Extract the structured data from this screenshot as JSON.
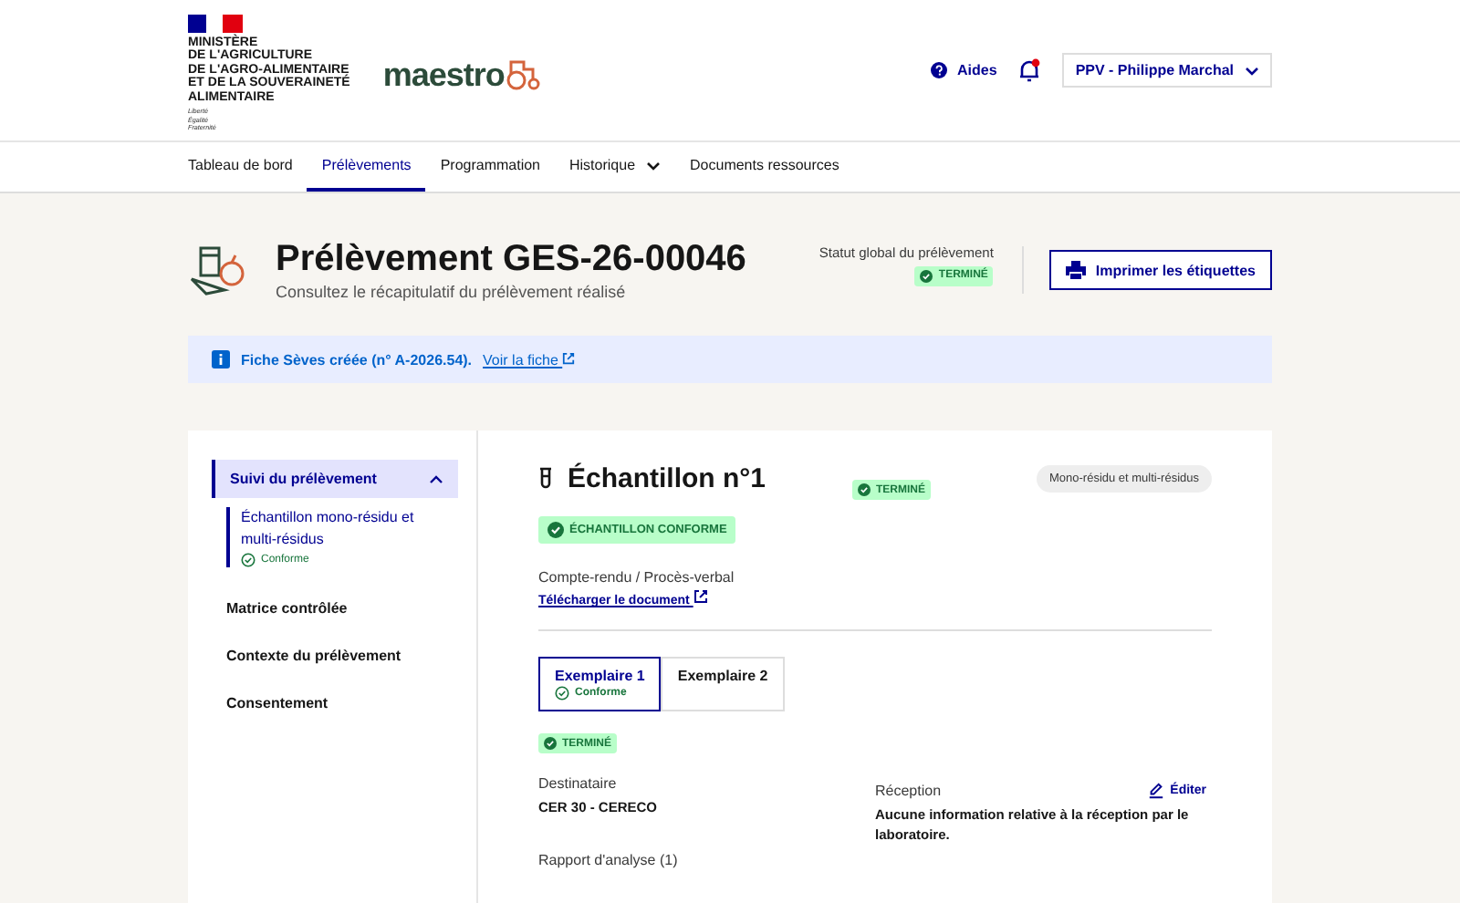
{
  "header": {
    "ministry": [
      "MINISTÈRE",
      "DE L'AGRICULTURE",
      "DE L'AGRO-ALIMENTAIRE",
      "ET DE LA SOUVERAINETÉ",
      "ALIMENTAIRE"
    ],
    "motto": [
      "Liberté",
      "Égalité",
      "Fraternité"
    ],
    "app_name": "maestro",
    "help": "Aides",
    "notifications_unread": true,
    "user": "PPV - Philippe Marchal"
  },
  "nav": [
    {
      "label": "Tableau de bord",
      "selected": false,
      "has_menu": false
    },
    {
      "label": "Prélèvements",
      "selected": true,
      "has_menu": false
    },
    {
      "label": "Programmation",
      "selected": false,
      "has_menu": false
    },
    {
      "label": "Historique",
      "selected": false,
      "has_menu": true
    },
    {
      "label": "Documents ressources",
      "selected": false,
      "has_menu": false
    }
  ],
  "page": {
    "title": "Prélèvement GES-26-00046",
    "subtitle": "Consultez le récapitulatif du prélèvement réalisé",
    "status_label": "Statut global du prélèvement",
    "status": "TERMINÉ",
    "print_button": "Imprimer les étiquettes"
  },
  "alert": {
    "text": "Fiche Sèves créée (n° A-2026.54).",
    "link": "Voir la fiche"
  },
  "sidebar": [
    {
      "label": "Suivi du prélèvement",
      "selected": true,
      "expanded": true,
      "children": [
        {
          "label": "Échantillon mono-résidu et multi-résidus",
          "status": "Conforme"
        }
      ]
    },
    {
      "label": "Matrice contrôlée",
      "selected": false
    },
    {
      "label": "Contexte du prélèvement",
      "selected": false
    },
    {
      "label": "Consentement",
      "selected": false
    }
  ],
  "sample": {
    "title": "Échantillon n°1",
    "status": "TERMINÉ",
    "tag": "Mono-résidu et multi-résidus",
    "conformity": "ÉCHANTILLON CONFORME",
    "report_label": "Compte-rendu / Procès-verbal",
    "report_link": "Télécharger le document",
    "copies": [
      {
        "label": "Exemplaire 1",
        "status": "Conforme",
        "selected": true
      },
      {
        "label": "Exemplaire 2",
        "selected": false
      }
    ],
    "copy_status": "TERMINÉ",
    "recipient_label": "Destinataire",
    "recipient": "CER 30 - CERECO",
    "reception_label": "Réception",
    "edit": "Éditer",
    "reception_text": "Aucune information relative à la réception par le laboratoire.",
    "analysis_label": "Rapport d'analyse (1)"
  }
}
